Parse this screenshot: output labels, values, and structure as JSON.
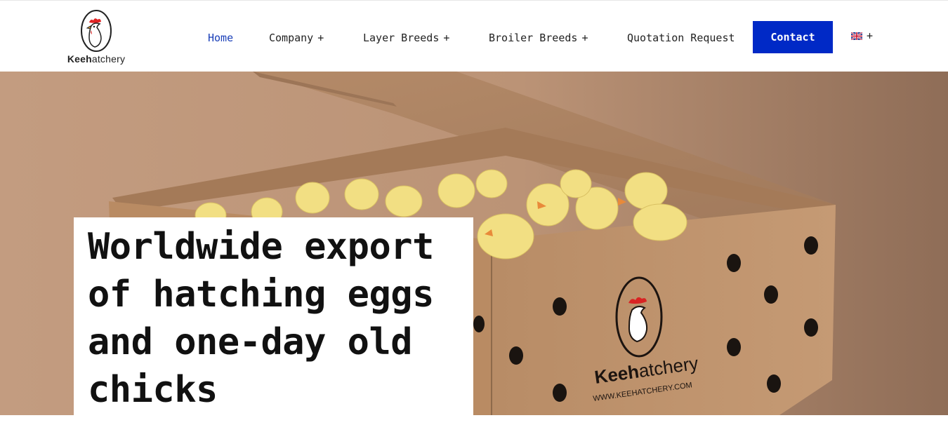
{
  "brand": {
    "logo_bold": "Keeh",
    "logo_rest": "atchery"
  },
  "nav": {
    "home": "Home",
    "company": "Company",
    "layer_breeds": "Layer Breeds",
    "broiler_breeds": "Broiler Breeds",
    "quotation": "Quotation Request",
    "contact": "Contact",
    "expand_symbol": "+"
  },
  "hero": {
    "headline": "Worldwide export of hatching eggs and one-day old chicks",
    "box_brand_bold": "Keeh",
    "box_brand_rest": "atchery",
    "box_url": "WWW.KEEHATCHERY.COM"
  },
  "colors": {
    "accent": "#0029c6",
    "active_link": "#1a3fb8"
  },
  "icons": {
    "language": "uk-flag-icon",
    "logo": "rooster-logo-icon"
  }
}
